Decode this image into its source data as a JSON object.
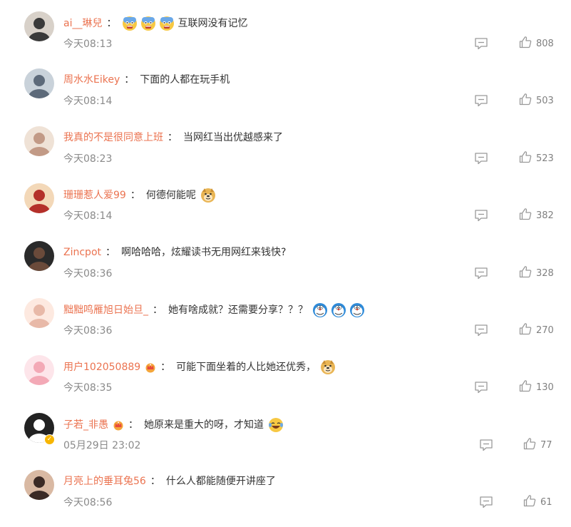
{
  "colors": {
    "username": "#eb7350",
    "text": "#333333",
    "meta": "#8a8a8a",
    "icon": "#999999"
  },
  "comments": [
    {
      "user": "ai__琳兒",
      "separator": "：",
      "text": "互联网没有记忆",
      "emoji_before": [
        "fearful-face-icon",
        "fearful-face-icon",
        "fearful-face-icon"
      ],
      "emoji_after": [],
      "time": "今天08:13",
      "likes": "808"
    },
    {
      "user": "周水水Eikey",
      "separator": "：",
      "text": "下面的人都在玩手机",
      "emoji_before": [],
      "emoji_after": [],
      "time": "今天08:14",
      "likes": "503"
    },
    {
      "user": "我真的不是很同意上班",
      "separator": "：",
      "text": "当网红当出优越感来了",
      "emoji_before": [],
      "emoji_after": [],
      "time": "今天08:23",
      "likes": "523"
    },
    {
      "user": "珊珊惹人爱99",
      "separator": "：",
      "text": "何德何能呢",
      "emoji_before": [],
      "emoji_after": [
        "doge-icon"
      ],
      "time": "今天08:14",
      "likes": "382"
    },
    {
      "user": "Zincpot",
      "separator": "：",
      "text": "啊哈哈哈，炫耀读书无用网红来钱快?",
      "emoji_before": [],
      "emoji_after": [],
      "time": "今天08:36",
      "likes": "328"
    },
    {
      "user": "黜黜鸣雁旭日始旦_",
      "separator": "：",
      "text": "她有啥成就？还需要分享？？？",
      "emoji_before": [],
      "emoji_after": [
        "doraemon-icon",
        "doraemon-icon",
        "doraemon-icon"
      ],
      "time": "今天08:36",
      "likes": "270"
    },
    {
      "user": "用户102050889",
      "separator": "：",
      "text": "可能下面坐着的人比她还优秀，",
      "emoji_before": [],
      "emoji_after": [
        "doge-icon"
      ],
      "time": "今天08:35",
      "likes": "130",
      "crown": true
    },
    {
      "user": "子若_非愚",
      "separator": "：",
      "text": "她原来是重大的呀，才知道",
      "emoji_before": [],
      "emoji_after": [
        "laugh-tears-icon"
      ],
      "time": "05月29日 23:02",
      "likes": "77",
      "crown": true,
      "verified": true
    },
    {
      "user": "月亮上的垂耳兔56",
      "separator": "：",
      "text": "什么人都能随便开讲座了",
      "emoji_before": [],
      "emoji_after": [],
      "time": "今天08:56",
      "likes": "61"
    }
  ]
}
